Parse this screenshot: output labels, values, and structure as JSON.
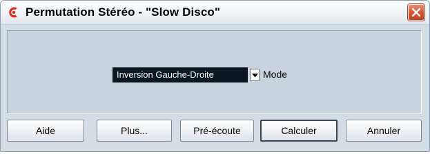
{
  "window": {
    "title": "Permutation Stéréo - \"Slow Disco\""
  },
  "mode": {
    "selected": "Inversion Gauche-Droite",
    "label": "Mode"
  },
  "buttons": {
    "help": "Aide",
    "more": "Plus...",
    "preview": "Pré-écoute",
    "process": "Calculer",
    "cancel": "Annuler"
  },
  "icons": {
    "app": "cubase-logo-icon",
    "close": "close-icon",
    "dropdown": "chevron-down-icon"
  },
  "colors": {
    "dialog_background": "#d4dce4",
    "panel_background": "#c9d3dd",
    "close_button": "#d4532e",
    "app_logo": "#e0281e",
    "select_background": "#0b1620"
  }
}
